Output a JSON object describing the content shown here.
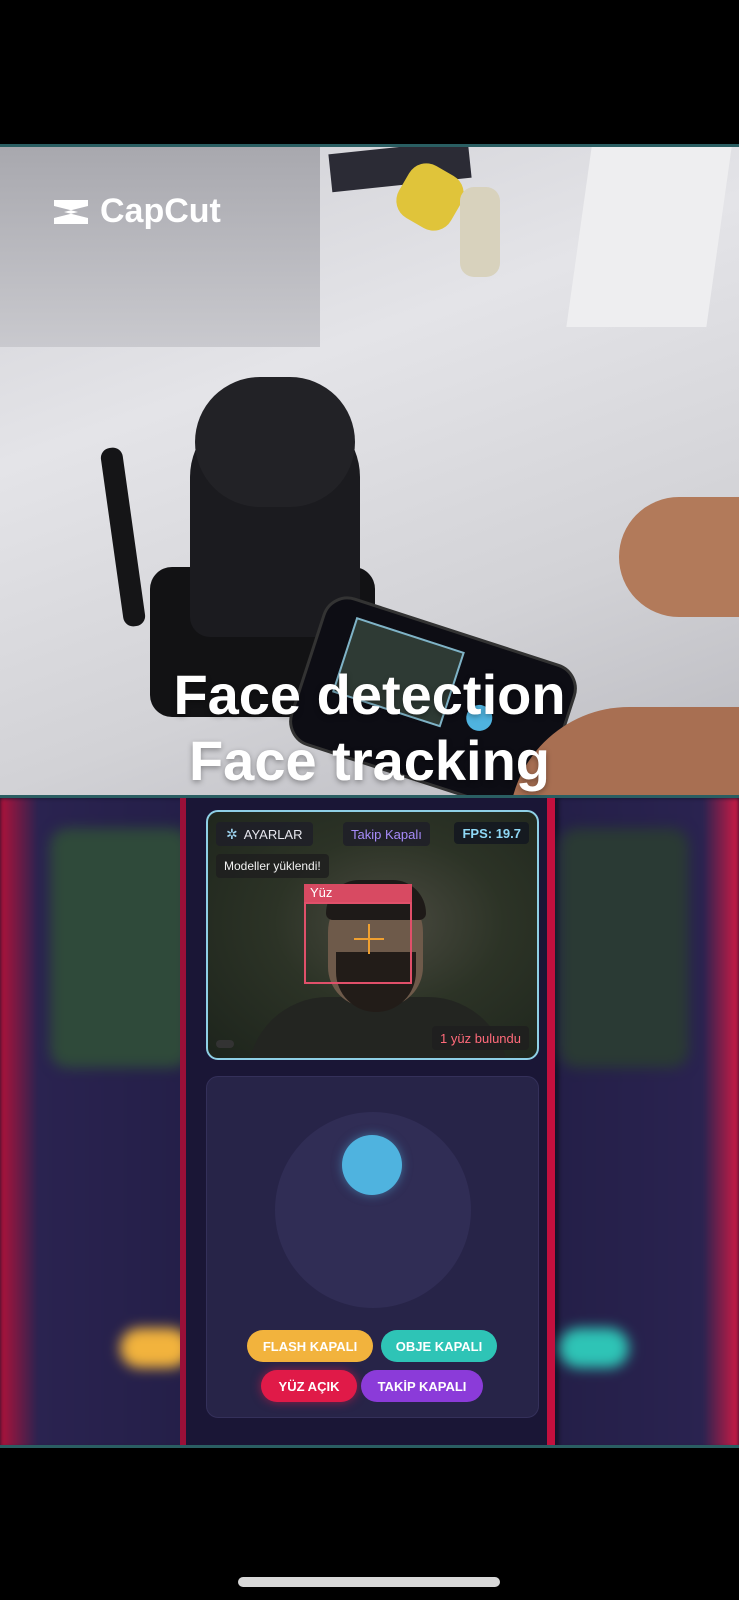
{
  "overlay": {
    "logo_text": "CapCut",
    "caption_line1": "Face detection",
    "caption_line2": "Face tracking"
  },
  "app": {
    "settings_label": "AYARLAR",
    "settings_icon": "gear-icon",
    "tracking_status": "Takip Kapalı",
    "fps_label": "FPS: 19.7",
    "models_message": "Modeller yüklendi!",
    "face_label": "Yüz",
    "faces_found": "1 yüz bulundu",
    "buttons": {
      "flash": "FLASH KAPALI",
      "object": "OBJE KAPALI",
      "face": "YÜZ AÇIK",
      "tracking": "TAKİP KAPALI"
    }
  },
  "colors": {
    "accent_blue": "#4fb3df",
    "flash": "#f2b33d",
    "object": "#2ec4b6",
    "face": "#e01a48",
    "tracking": "#8b3bd9"
  }
}
